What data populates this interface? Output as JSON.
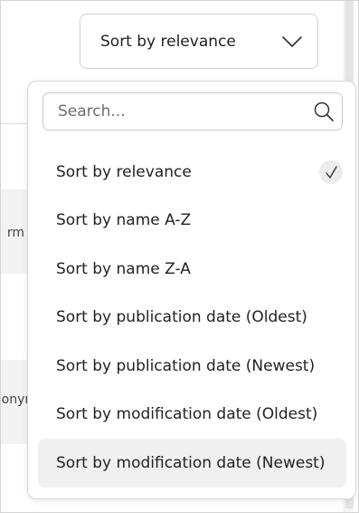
{
  "sort": {
    "current_label": "Sort by relevance",
    "chevron_icon": "chevron-down-icon"
  },
  "search": {
    "placeholder": "Search...",
    "value": "",
    "icon": "search-icon"
  },
  "options": [
    {
      "label": "Sort by relevance",
      "selected": true,
      "highlighted": false
    },
    {
      "label": "Sort by name A-Z",
      "selected": false,
      "highlighted": false
    },
    {
      "label": "Sort by name Z-A",
      "selected": false,
      "highlighted": false
    },
    {
      "label": "Sort by publication date (Oldest)",
      "selected": false,
      "highlighted": false
    },
    {
      "label": "Sort by publication date (Newest)",
      "selected": false,
      "highlighted": false
    },
    {
      "label": "Sort by modification date (Oldest)",
      "selected": false,
      "highlighted": false
    },
    {
      "label": "Sort by modification date (Newest)",
      "selected": false,
      "highlighted": true
    }
  ],
  "background": {
    "card_1_text": "rm A",
    "card_2_text": "onym"
  },
  "colors": {
    "highlight": "#f0f0f1",
    "check_bg": "#ebebeb",
    "border": "#cfcfcf"
  }
}
